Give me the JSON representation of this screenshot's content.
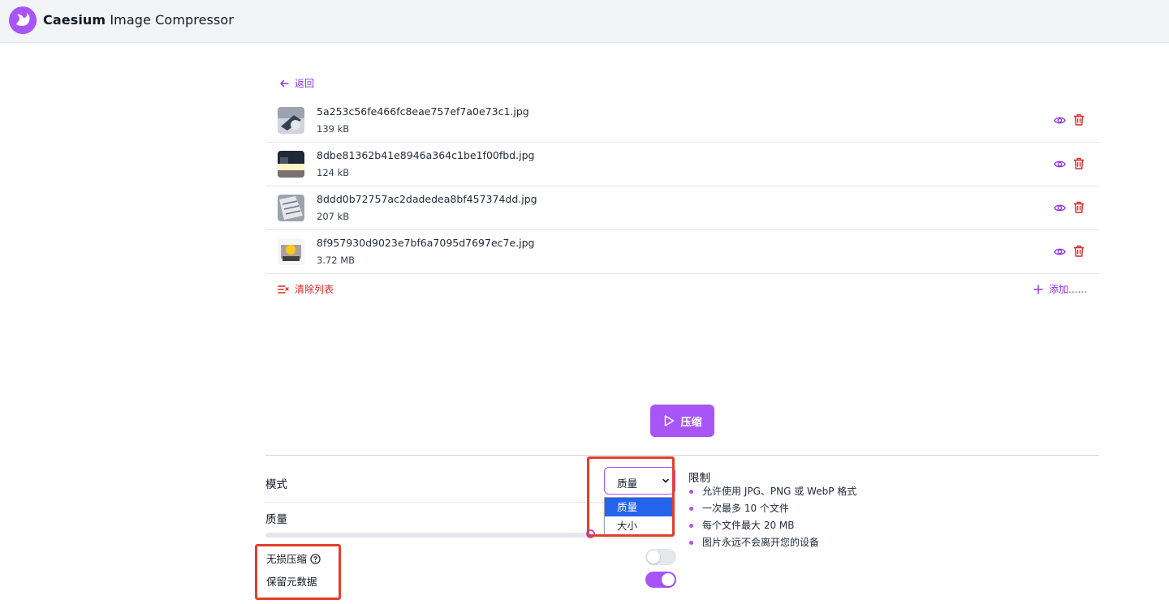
{
  "app": {
    "title_bold": "Caesium",
    "title_rest": " Image Compressor",
    "accent": "#a855f7"
  },
  "nav": {
    "back_label": "返回"
  },
  "files": [
    {
      "name": "5a253c56fe466fc8eae757ef7a0e73c1.jpg",
      "size": "139 kB"
    },
    {
      "name": "8dbe81362b41e8946a364c1be1f00fbd.jpg",
      "size": "124 kB"
    },
    {
      "name": "8ddd0b72757ac2dadedea8bf457374dd.jpg",
      "size": "207 kB"
    },
    {
      "name": "8f957930d9023e7bf6a7095d7697ec7e.jpg",
      "size": "3.72 MB"
    }
  ],
  "list_actions": {
    "clear_label": "清除列表",
    "add_label": "添加......"
  },
  "compress": {
    "label": "压缩"
  },
  "settings": {
    "mode_label": "模式",
    "mode_value": "质量",
    "mode_options": [
      "质量",
      "大小"
    ],
    "quality_label": "质量",
    "quality_value": 1.0,
    "lossless_label": "无损压缩",
    "lossless_on": false,
    "keep_metadata_label": "保留元数据",
    "keep_metadata_on": true
  },
  "limits": {
    "title": "限制",
    "items": [
      "允许使用 JPG、PNG 或 WebP 格式",
      "一次最多 10 个文件",
      "每个文件最大 20 MB",
      "图片永远不会离开您的设备"
    ]
  },
  "colors": {
    "accent": "#a855f7",
    "danger": "#dc2626",
    "selected_option": "#2563eb",
    "highlight": "#e2402a"
  }
}
